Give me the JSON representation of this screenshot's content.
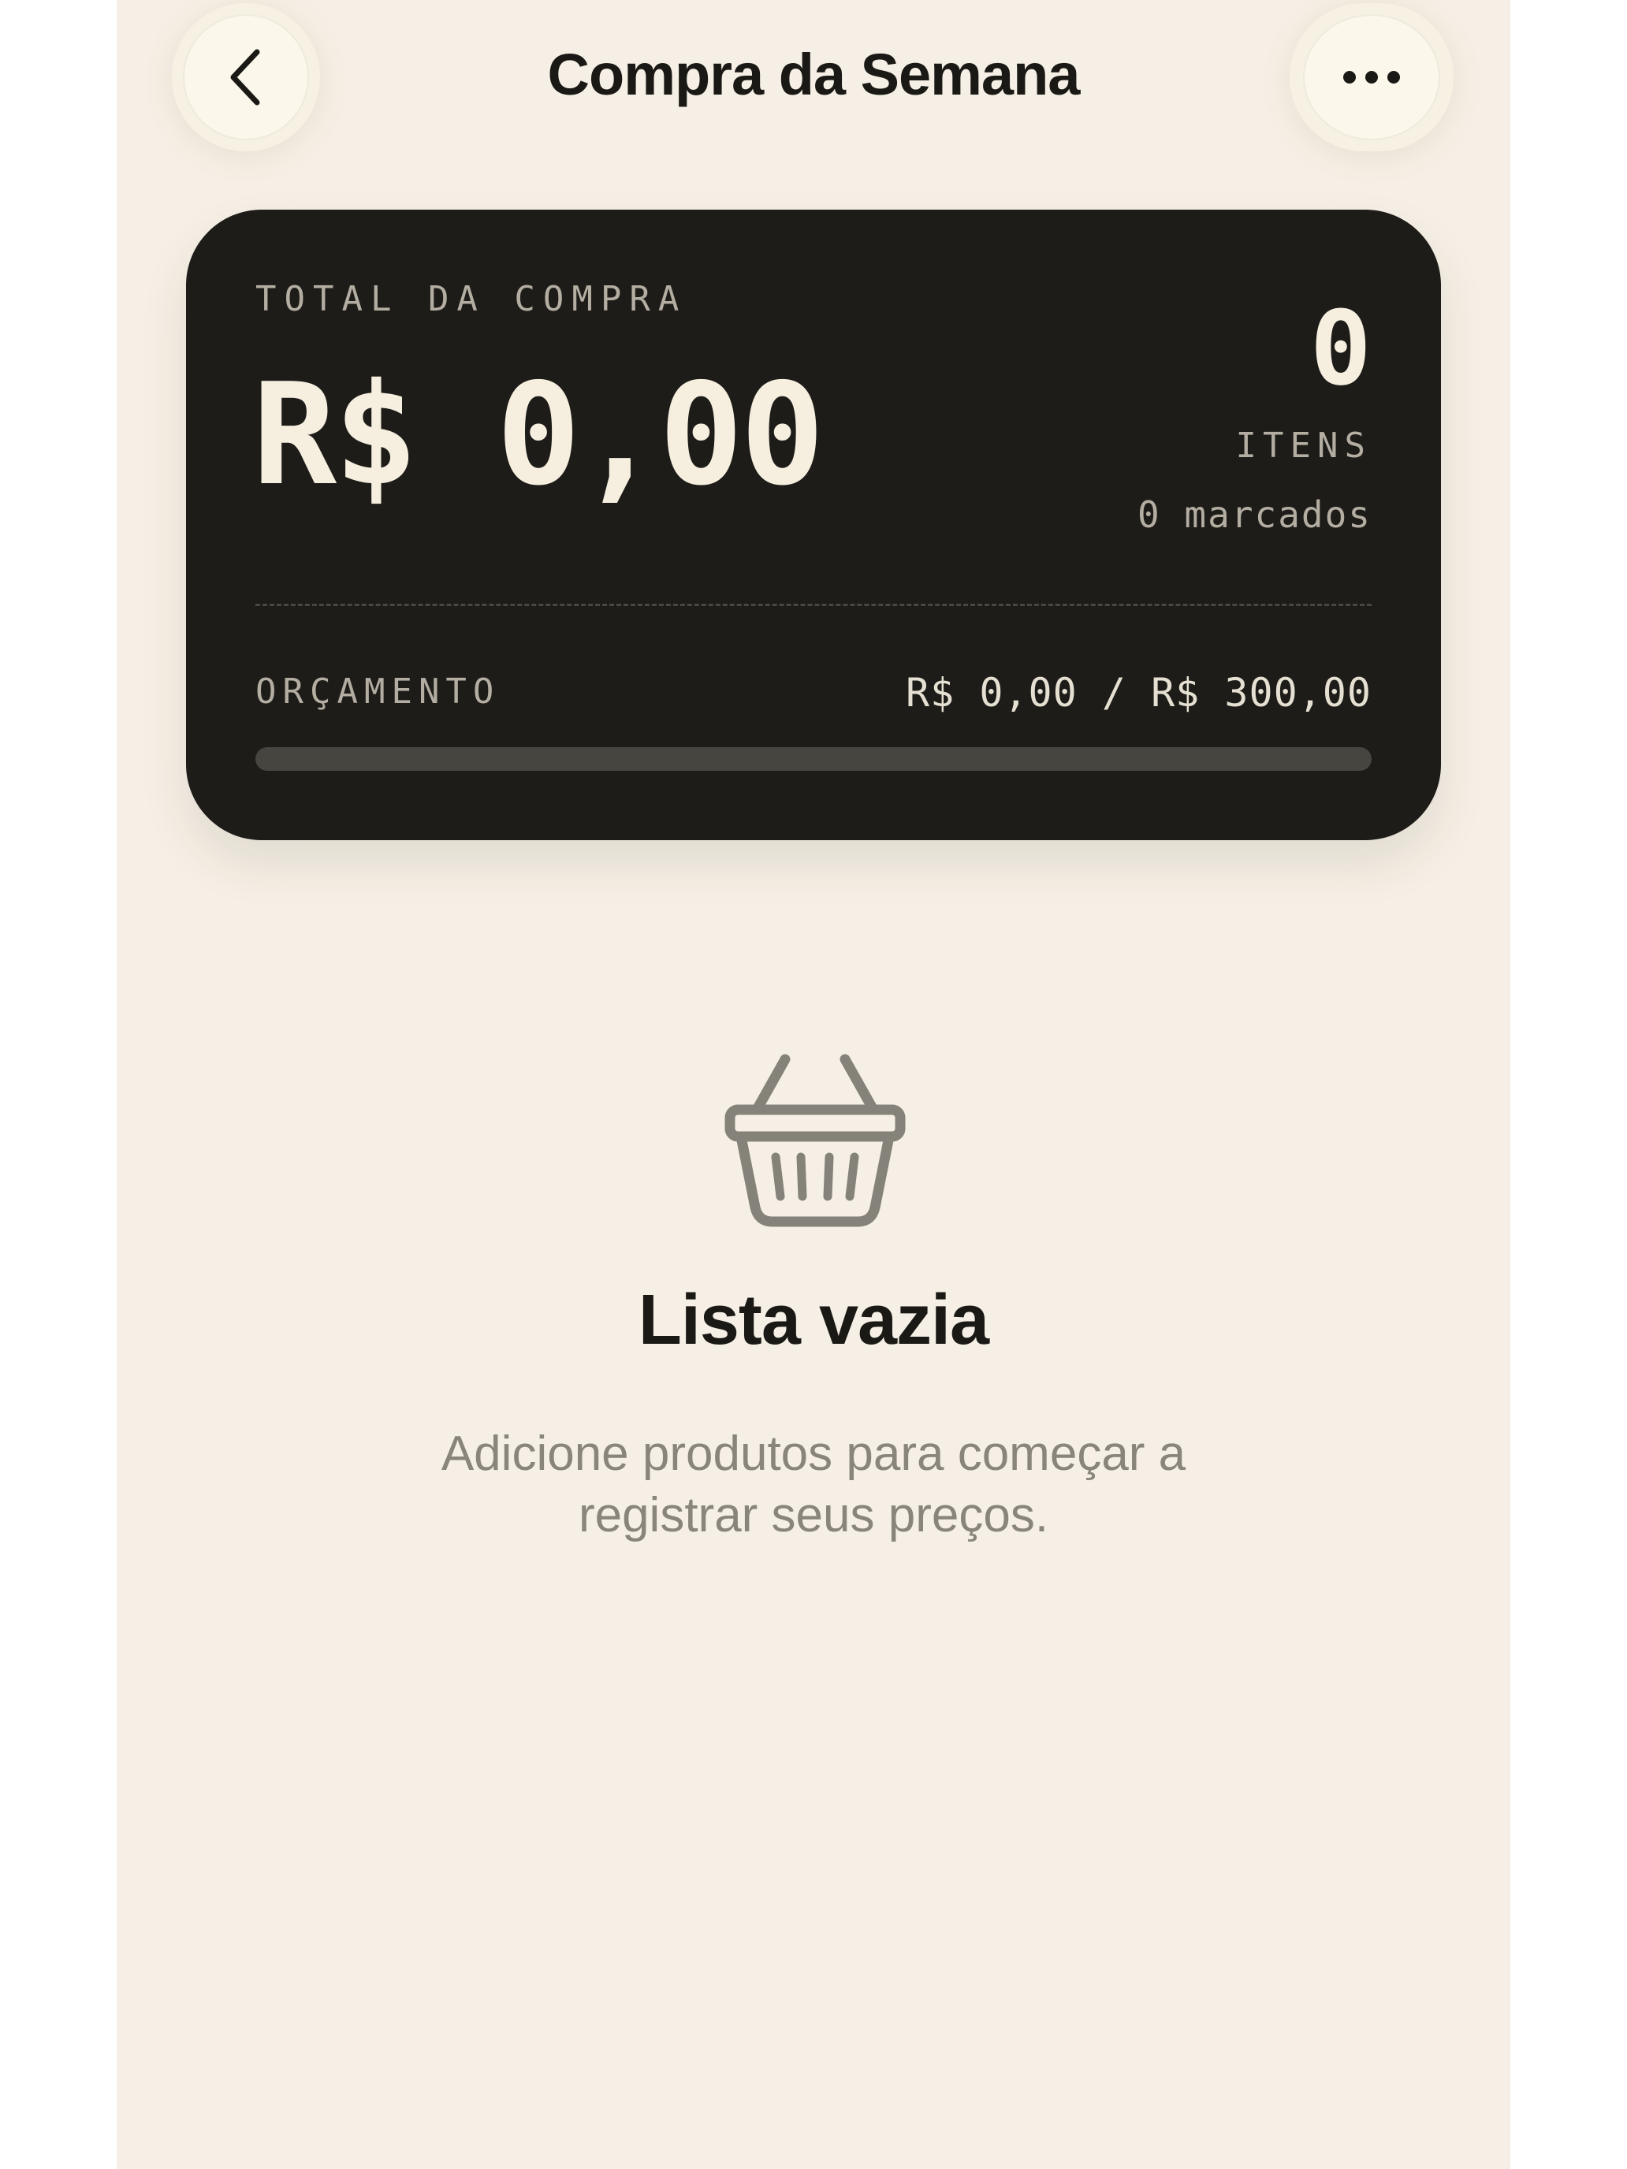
{
  "header": {
    "title": "Compra da Semana",
    "back_icon": "chevron-left-icon",
    "more_icon": "ellipsis-icon"
  },
  "summary": {
    "total_label": "TOTAL DA COMPRA",
    "total_value": "R$ 0,00",
    "items_count": "0",
    "items_label": "ITENS",
    "marked_label": "0 marcados",
    "budget_label": "ORÇAMENTO",
    "budget_value": "R$ 0,00 / R$ 300,00",
    "budget_progress_percent": 0
  },
  "empty_state": {
    "icon": "basket-icon",
    "title": "Lista vazia",
    "description": "Adicione produtos para começar a registrar seus preços."
  },
  "colors": {
    "background": "#f5efe5",
    "card": "#1d1c18",
    "text_primary": "#1a1915",
    "text_muted": "#8a857b"
  }
}
